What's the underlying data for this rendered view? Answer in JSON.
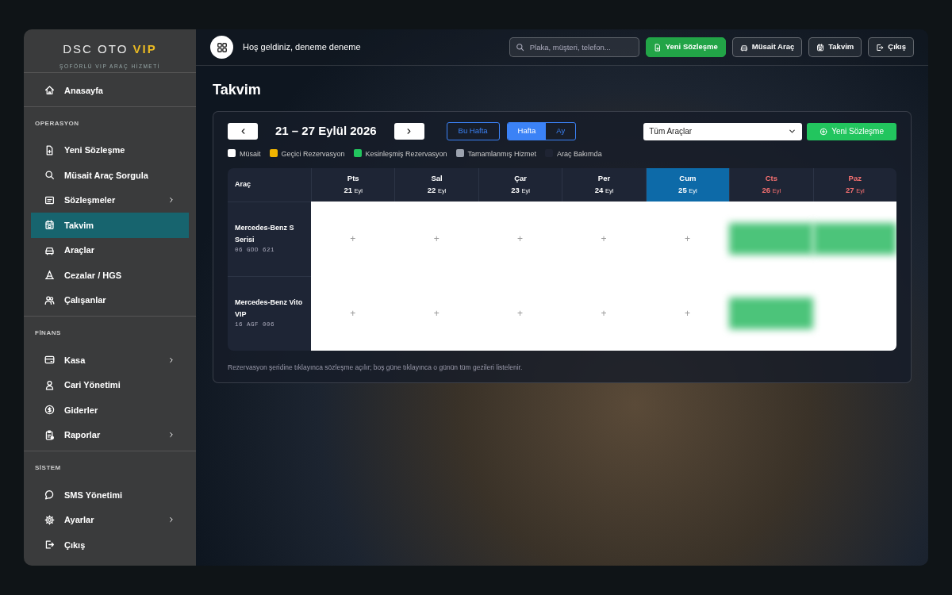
{
  "brand": {
    "name": "DSC OTO",
    "highlight": "VIP",
    "tagline": "ŞOFÖRLÜ VIP ARAÇ HİZMETİ"
  },
  "sidebar": {
    "sections": [
      {
        "items": [
          {
            "label": "Anasayfa",
            "selected": false,
            "submenu": false
          }
        ]
      },
      {
        "title": "OPERASYON",
        "items": [
          {
            "label": "Yeni Sözleşme",
            "selected": false,
            "submenu": false
          },
          {
            "label": "Müsait Araç Sorgula",
            "selected": false,
            "submenu": false
          },
          {
            "label": "Sözleşmeler",
            "selected": false,
            "submenu": true
          },
          {
            "label": "Takvim",
            "selected": true,
            "submenu": false
          },
          {
            "label": "Araçlar",
            "selected": false,
            "submenu": false
          },
          {
            "label": "Cezalar / HGS",
            "selected": false,
            "submenu": false
          },
          {
            "label": "Çalışanlar",
            "selected": false,
            "submenu": false
          }
        ]
      },
      {
        "title": "FİNANS",
        "items": [
          {
            "label": "Kasa",
            "selected": false,
            "submenu": true
          },
          {
            "label": "Cari Yönetimi",
            "selected": false,
            "submenu": false
          },
          {
            "label": "Giderler",
            "selected": false,
            "submenu": false
          },
          {
            "label": "Raporlar",
            "selected": false,
            "submenu": true
          }
        ]
      },
      {
        "title": "SİSTEM",
        "items": [
          {
            "label": "SMS Yönetimi",
            "selected": false,
            "submenu": false
          },
          {
            "label": "Ayarlar",
            "selected": false,
            "submenu": true
          },
          {
            "label": "Çıkış",
            "selected": false,
            "submenu": false
          }
        ]
      }
    ]
  },
  "topbar": {
    "greeting": "Hoş geldiniz, deneme deneme",
    "search": {
      "placeholder": "Plaka, müşteri, telefon..."
    },
    "buttons": [
      {
        "label": "Yeni Sözleşme",
        "kind": "primary"
      },
      {
        "label": "Müsait Araç",
        "kind": "outline"
      },
      {
        "label": "Takvim",
        "kind": "outline"
      },
      {
        "label": "Çıkış",
        "kind": "outline"
      }
    ]
  },
  "page_title": "Takvim",
  "calendar": {
    "range": "21 – 27 Eylül 2026",
    "today_button": "Bu Hafta",
    "views": [
      {
        "label": "Hafta",
        "selected": true
      },
      {
        "label": "Ay",
        "selected": false
      }
    ],
    "vehicle_filter": "Tüm Araçlar",
    "new_button": "Yeni Sözleşme",
    "legend": [
      {
        "label": "Müsait",
        "color": "#ffffff"
      },
      {
        "label": "Geçici Rezervasyon",
        "color": "#f0b400"
      },
      {
        "label": "Kesinleşmiş Rezervasyon",
        "color": "#22c55e"
      },
      {
        "label": "Tamamlanmış Hizmet",
        "color": "#9ca3af"
      },
      {
        "label": "Araç Bakımda",
        "color": "#1f2433"
      }
    ],
    "vehicle_header": "Araç",
    "days": [
      {
        "name": "Pts",
        "date": "21",
        "month": "Eyl",
        "weekend": false,
        "today": false
      },
      {
        "name": "Sal",
        "date": "22",
        "month": "Eyl",
        "weekend": false,
        "today": false
      },
      {
        "name": "Çar",
        "date": "23",
        "month": "Eyl",
        "weekend": false,
        "today": false
      },
      {
        "name": "Per",
        "date": "24",
        "month": "Eyl",
        "weekend": false,
        "today": false
      },
      {
        "name": "Cum",
        "date": "25",
        "month": "Eyl",
        "weekend": false,
        "today": true
      },
      {
        "name": "Cts",
        "date": "26",
        "month": "Eyl",
        "weekend": true,
        "today": false
      },
      {
        "name": "Paz",
        "date": "27",
        "month": "Eyl",
        "weekend": true,
        "today": false
      }
    ],
    "rows": [
      {
        "vehicle": "Mercedes-Benz S Serisi",
        "plate": "06 GDD 621",
        "cells": [
          {
            "kind": "add",
            "label": "+"
          },
          {
            "kind": "add",
            "label": "+"
          },
          {
            "kind": "add",
            "label": "+"
          },
          {
            "kind": "add",
            "label": "+"
          },
          {
            "kind": "add",
            "label": "+"
          },
          {
            "kind": "reservation"
          },
          {
            "kind": "reservation"
          }
        ]
      },
      {
        "vehicle": "Mercedes-Benz Vito VIP",
        "plate": "16 AGF 006",
        "cells": [
          {
            "kind": "add",
            "label": "+"
          },
          {
            "kind": "add",
            "label": "+"
          },
          {
            "kind": "add",
            "label": "+"
          },
          {
            "kind": "add",
            "label": "+"
          },
          {
            "kind": "add",
            "label": "+"
          },
          {
            "kind": "reservation"
          },
          {
            "kind": "blank"
          }
        ]
      }
    ],
    "footnote": "Rezervasyon şeridine tıklayınca sözleşme açılır; boş güne tıklayınca o günün tüm gezileri listelenir."
  }
}
